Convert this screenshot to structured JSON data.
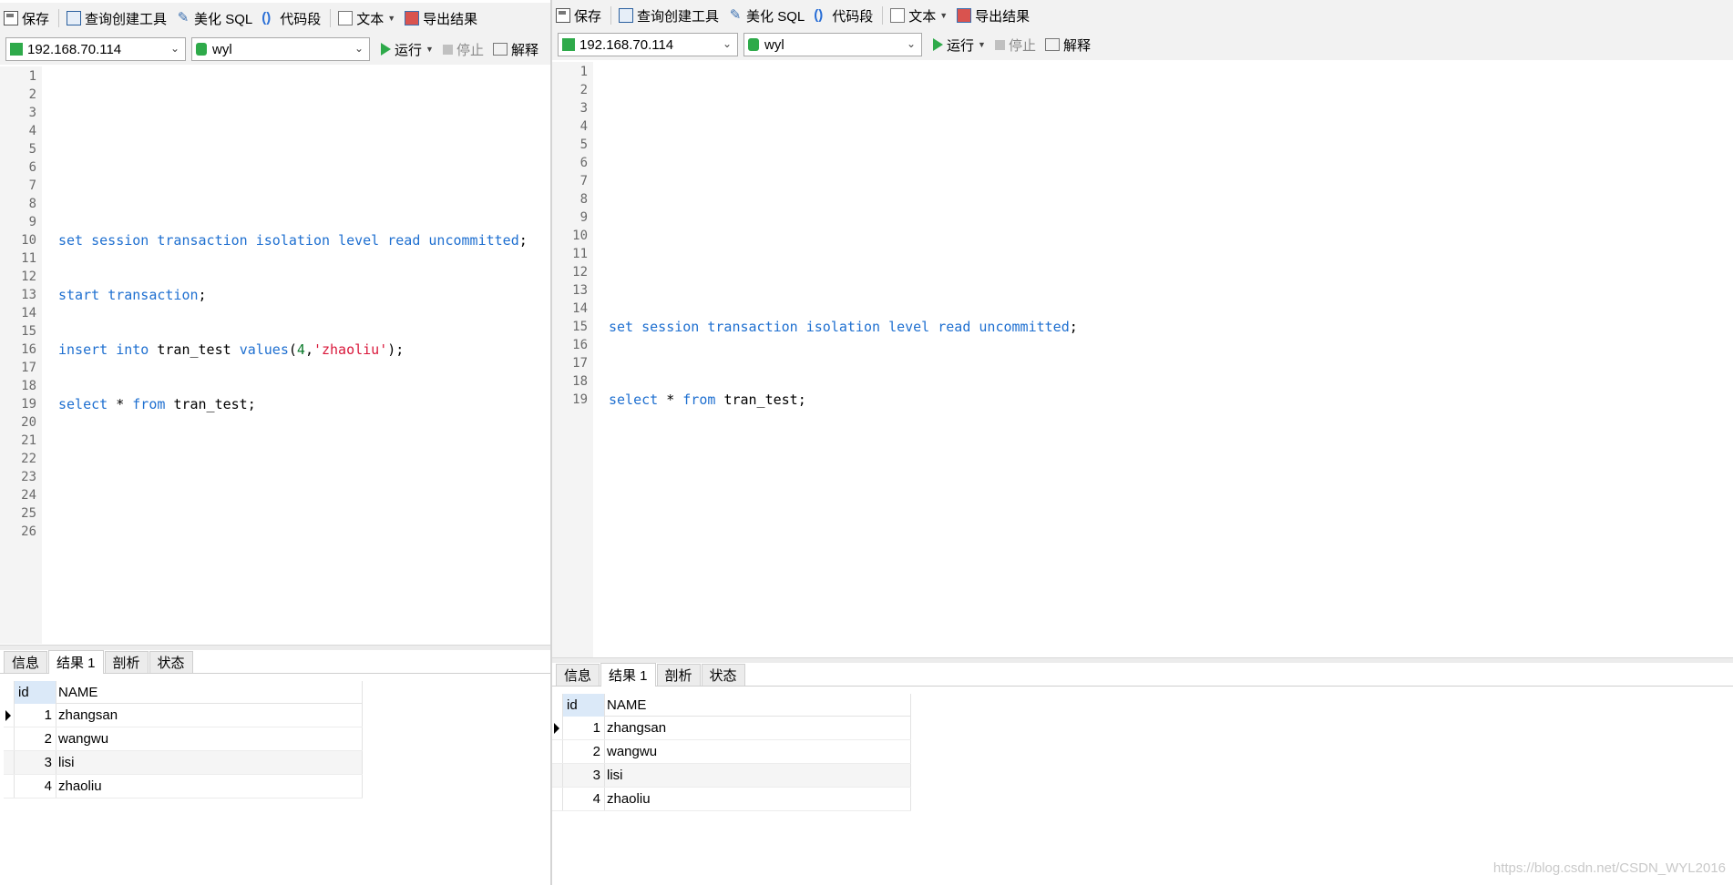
{
  "toolbar": {
    "save": "保存",
    "query_builder": "查询创建工具",
    "beautify": "美化 SQL",
    "snippet": "代码段",
    "text": "文本",
    "export": "导出结果"
  },
  "selectbar": {
    "connection": "192.168.70.114",
    "database": "wyl",
    "run": "运行",
    "stop": "停止",
    "explain": "解释"
  },
  "left_editor": {
    "line_numbers": [
      "1",
      "2",
      "3",
      "4",
      "5",
      "6",
      "7",
      "8",
      "9",
      "10",
      "11",
      "12",
      "13",
      "14",
      "15",
      "16",
      "17",
      "18",
      "19",
      "20",
      "21",
      "22",
      "23",
      "24",
      "25",
      "26"
    ],
    "code": {
      "l10_set": "set",
      "l10_session": "session",
      "l10_transaction": "transaction",
      "l10_isolation": "isolation",
      "l10_level": "level",
      "l10_read": "read",
      "l10_uncommitted": "uncommitted",
      "semicolon": ";",
      "l13_start": "start",
      "l13_transaction": "transaction",
      "l16_insert": "insert",
      "l16_into": "into",
      "l16_table": "tran_test",
      "l16_values": "values",
      "l16_paren_open": "(",
      "l16_num": "4",
      "l16_comma": ",",
      "l16_str": "'zhaoliu'",
      "l16_paren_close": ");",
      "l19_select": "select",
      "l19_star": "*",
      "l19_from": "from",
      "l19_table": "tran_test"
    }
  },
  "right_editor": {
    "line_numbers": [
      "1",
      "2",
      "3",
      "4",
      "5",
      "6",
      "7",
      "8",
      "9",
      "10",
      "11",
      "12",
      "13",
      "14",
      "15",
      "16",
      "17",
      "18",
      "19"
    ]
  },
  "result_tabs": [
    "信息",
    "结果 1",
    "剖析",
    "状态"
  ],
  "grid": {
    "columns": [
      "id",
      "NAME"
    ],
    "rows": [
      {
        "id": "1",
        "name": "zhangsan"
      },
      {
        "id": "2",
        "name": "wangwu"
      },
      {
        "id": "3",
        "name": "lisi"
      },
      {
        "id": "4",
        "name": "zhaoliu"
      }
    ]
  },
  "watermark": "https://blog.csdn.net/CSDN_WYL2016"
}
